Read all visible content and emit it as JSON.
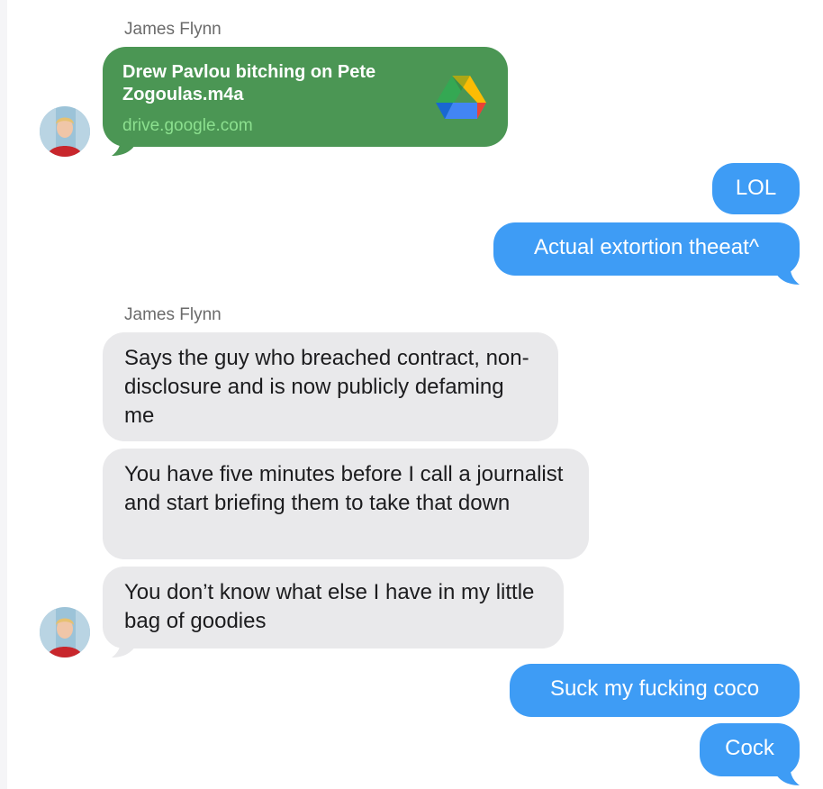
{
  "colors": {
    "incoming_bubble": "#e9e9eb",
    "outgoing_bubble": "#3e9cf5",
    "link_card": "#4b9654",
    "link_domain": "#8ce08f"
  },
  "messages": {
    "group1": {
      "sender": "James Flynn",
      "link": {
        "title": "Drew Pavlou bitching on Pete Zogoulas.m4a",
        "domain": "drive.google.com",
        "icon": "google-drive-icon"
      }
    },
    "outgoing1": [
      "LOL",
      "Actual extortion theeat^"
    ],
    "group2": {
      "sender": "James Flynn",
      "texts": [
        "Says the guy who breached contract, non-disclosure and is now publicly defaming me",
        "You have five minutes before I call a journalist and start briefing them to take that down",
        "You don’t know what else I have in my little bag of goodies"
      ]
    },
    "outgoing2": [
      "Suck my fucking coco",
      "Cock"
    ]
  }
}
